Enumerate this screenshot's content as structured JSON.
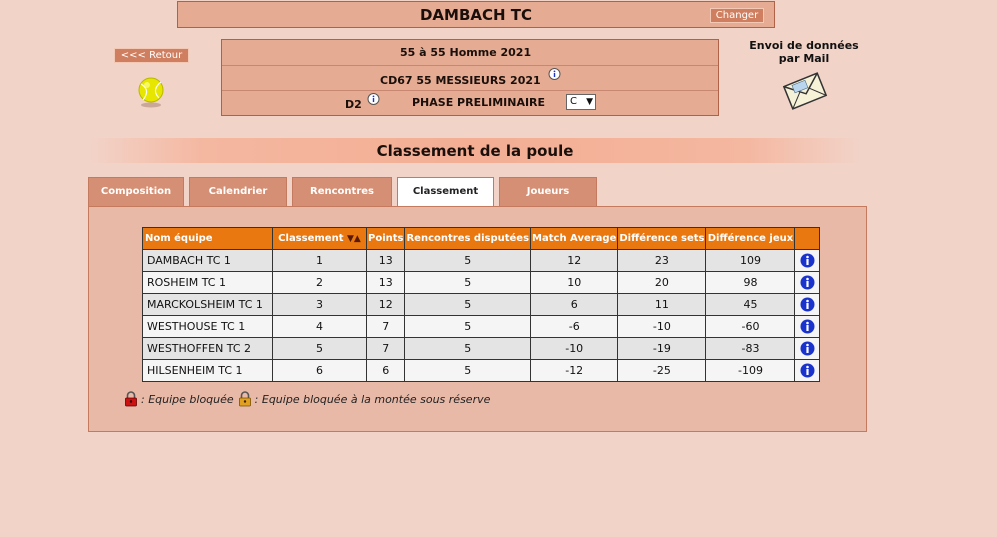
{
  "club": {
    "title": "DAMBACH TC",
    "change_label": "Changer"
  },
  "nav": {
    "back_label": "<<< Retour"
  },
  "competition": {
    "line1": "55  à 55  Homme  2021",
    "line2": "CD67 55 MESSIEURS 2021",
    "division": "D2",
    "phase": "PHASE PRELIMINAIRE",
    "poule_selected": "C"
  },
  "mail": {
    "label": "Envoi de données par Mail"
  },
  "section": {
    "title": "Classement de la poule"
  },
  "tabs": [
    {
      "label": "Composition"
    },
    {
      "label": "Calendrier"
    },
    {
      "label": "Rencontres"
    },
    {
      "label": "Classement",
      "active": true
    },
    {
      "label": "Joueurs"
    }
  ],
  "table": {
    "headers": [
      "Nom équipe",
      "Classement",
      "Points",
      "Rencontres disputées",
      "Match Average",
      "Différence sets",
      "Différence jeux"
    ],
    "rows": [
      {
        "team": "DAMBACH TC 1",
        "rank": "1",
        "points": "13",
        "played": "5",
        "match_avg": "12",
        "sets": "23",
        "games": "109"
      },
      {
        "team": "ROSHEIM TC 1",
        "rank": "2",
        "points": "13",
        "played": "5",
        "match_avg": "10",
        "sets": "20",
        "games": "98"
      },
      {
        "team": "MARCKOLSHEIM TC 1",
        "rank": "3",
        "points": "12",
        "played": "5",
        "match_avg": "6",
        "sets": "11",
        "games": "45"
      },
      {
        "team": "WESTHOUSE TC 1",
        "rank": "4",
        "points": "7",
        "played": "5",
        "match_avg": "-6",
        "sets": "-10",
        "games": "-60"
      },
      {
        "team": "WESTHOFFEN TC 2",
        "rank": "5",
        "points": "7",
        "played": "5",
        "match_avg": "-10",
        "sets": "-19",
        "games": "-83"
      },
      {
        "team": "HILSENHEIM TC 1",
        "rank": "6",
        "points": "6",
        "played": "5",
        "match_avg": "-12",
        "sets": "-25",
        "games": "-109"
      }
    ]
  },
  "legend": {
    "blocked": ": Equipe bloquée",
    "blocked_reserve": ": Equipe bloquée à la montée sous réserve"
  },
  "colors": {
    "header_orange": "#e8780f",
    "tab": "#d48f74",
    "background": "#f2d3c8",
    "info_blue": "#1a33cc"
  }
}
